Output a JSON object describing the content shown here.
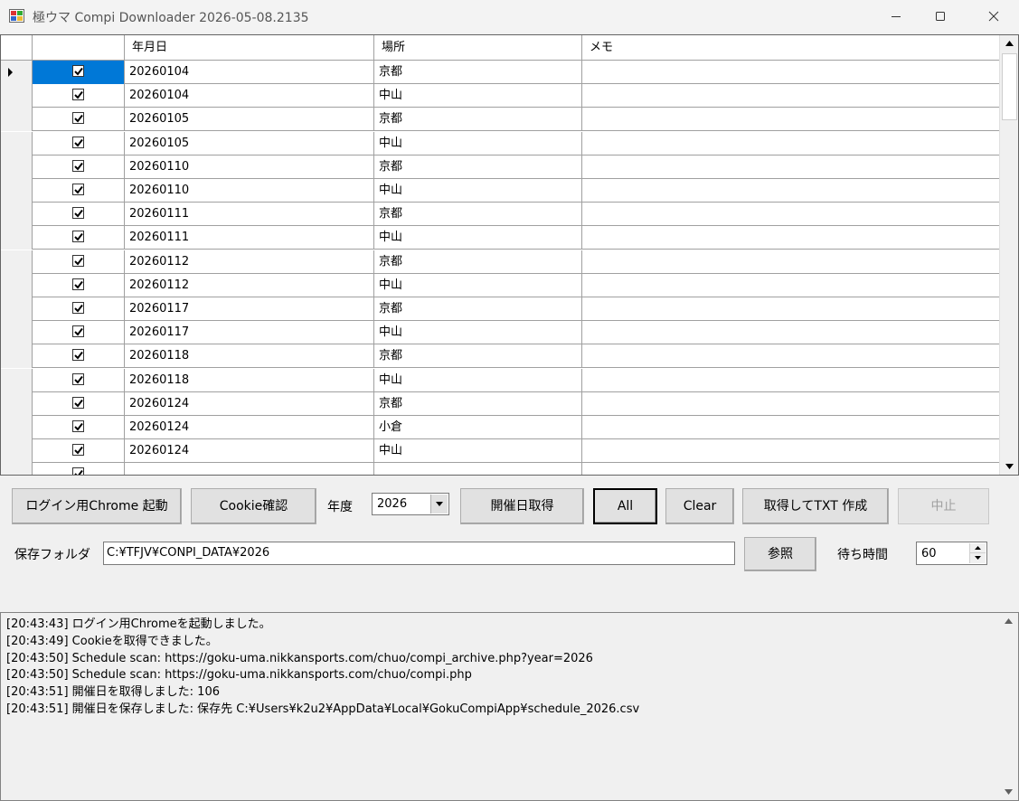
{
  "window": {
    "title": "極ウマ Compi Downloader 2026-05-08.2135"
  },
  "grid": {
    "columns": [
      "",
      "年月日",
      "場所",
      "メモ"
    ],
    "rows": [
      {
        "checked": true,
        "date": "20260104",
        "place": "京都",
        "memo": "",
        "selected": true
      },
      {
        "checked": true,
        "date": "20260104",
        "place": "中山",
        "memo": ""
      },
      {
        "checked": true,
        "date": "20260105",
        "place": "京都",
        "memo": ""
      },
      {
        "checked": true,
        "date": "20260105",
        "place": "中山",
        "memo": ""
      },
      {
        "checked": true,
        "date": "20260110",
        "place": "京都",
        "memo": ""
      },
      {
        "checked": true,
        "date": "20260110",
        "place": "中山",
        "memo": ""
      },
      {
        "checked": true,
        "date": "20260111",
        "place": "京都",
        "memo": ""
      },
      {
        "checked": true,
        "date": "20260111",
        "place": "中山",
        "memo": ""
      },
      {
        "checked": true,
        "date": "20260112",
        "place": "京都",
        "memo": ""
      },
      {
        "checked": true,
        "date": "20260112",
        "place": "中山",
        "memo": ""
      },
      {
        "checked": true,
        "date": "20260117",
        "place": "京都",
        "memo": ""
      },
      {
        "checked": true,
        "date": "20260117",
        "place": "中山",
        "memo": ""
      },
      {
        "checked": true,
        "date": "20260118",
        "place": "京都",
        "memo": ""
      },
      {
        "checked": true,
        "date": "20260118",
        "place": "中山",
        "memo": ""
      },
      {
        "checked": true,
        "date": "20260124",
        "place": "京都",
        "memo": ""
      },
      {
        "checked": true,
        "date": "20260124",
        "place": "小倉",
        "memo": ""
      },
      {
        "checked": true,
        "date": "20260124",
        "place": "中山",
        "memo": ""
      },
      {
        "checked": true,
        "date": "",
        "place": "",
        "memo": ""
      }
    ]
  },
  "toolbar": {
    "login_chrome_label": "ログイン用Chrome 起動",
    "cookie_check_label": "Cookie確認",
    "year_label": "年度",
    "year_value": "2026",
    "fetch_dates_label": "開催日取得",
    "all_label": "All",
    "clear_label": "Clear",
    "fetch_txt_label": "取得してTXT 作成",
    "stop_label": "中止"
  },
  "folder": {
    "label": "保存フォルダ",
    "path": "C:¥TFJV¥CONPI_DATA¥2026",
    "browse_label": "参照",
    "wait_label": "待ち時間",
    "wait_value": "60"
  },
  "log": {
    "lines": [
      "[20:43:43] ログイン用Chromeを起動しました。",
      "[20:43:49] Cookieを取得できました。",
      "[20:43:50] Schedule scan: https://goku-uma.nikkansports.com/chuo/compi_archive.php?year=2026",
      "[20:43:50] Schedule scan: https://goku-uma.nikkansports.com/chuo/compi.php",
      "[20:43:51] 開催日を取得しました: 106",
      "[20:43:51] 開催日を保存しました: 保存先 C:¥Users¥k2u2¥AppData¥Local¥GokuCompiApp¥schedule_2026.csv"
    ]
  },
  "colors": {
    "selection": "#0078d7",
    "window_bg": "#f0f0f0"
  }
}
